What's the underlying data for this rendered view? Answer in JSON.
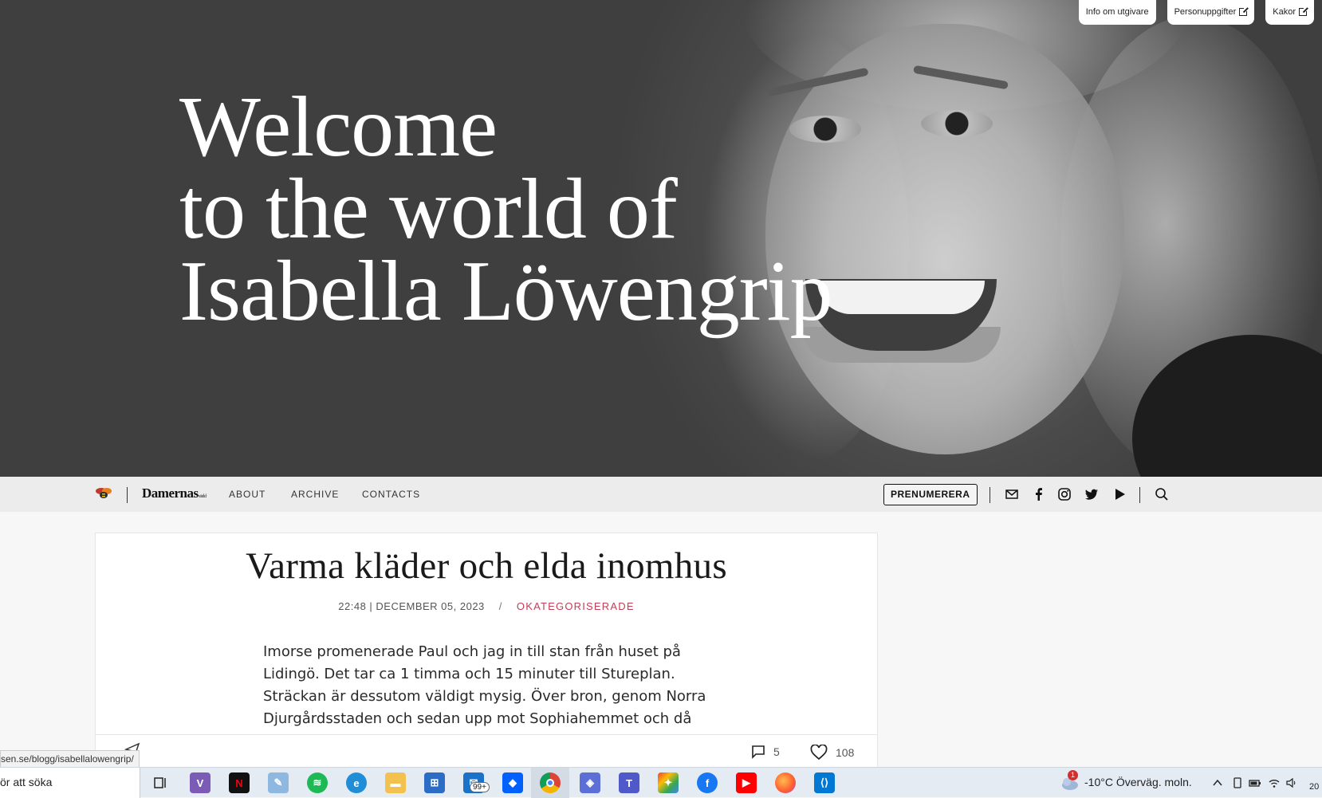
{
  "top_links": [
    {
      "label": "Info om utgivare",
      "external": false
    },
    {
      "label": "Personuppgifter",
      "external": true
    },
    {
      "label": "Kakor",
      "external": true
    }
  ],
  "hero": {
    "title_lines": [
      "Welcome",
      "to the world of",
      "Isabella Löwengrip"
    ]
  },
  "nav": {
    "brand": "Damernas",
    "brand_suffix": "värld",
    "items": [
      "ABOUT",
      "ARCHIVE",
      "CONTACTS"
    ],
    "subscribe_label": "PRENUMERERA",
    "icons": [
      "mail-icon",
      "facebook-icon",
      "instagram-icon",
      "twitter-icon",
      "youtube-icon",
      "search-icon"
    ]
  },
  "article": {
    "title": "Varma kläder och elda inomhus",
    "date": "22:48 | DECEMBER 05, 2023",
    "separator": "/",
    "category": "OKATEGORISERADE",
    "body_lines": [
      "Imorse promenerade Paul och jag in till stan från huset på",
      "Lidingö. Det tar ca 1 timma och 15 minuter till Stureplan.",
      "Sträckan är dessutom väldigt mysig. Över bron, genom Norra",
      "Djurgårdsstaden och sedan upp mot Sophiahemmet och då"
    ],
    "comments_count": "5",
    "likes_count": "108"
  },
  "status_url": "sen.se/blogg/isabellalowengrip/",
  "taskbar": {
    "search_text": "ör att söka",
    "mail_badge": "99+",
    "weather_badge": "1",
    "weather": "-10°C  Överväg. moln.",
    "clock_fragment": "20"
  },
  "colors": {
    "category": "#c0405a",
    "navbar_bg": "#ececec",
    "hero_bg": "#3f3f3f"
  }
}
